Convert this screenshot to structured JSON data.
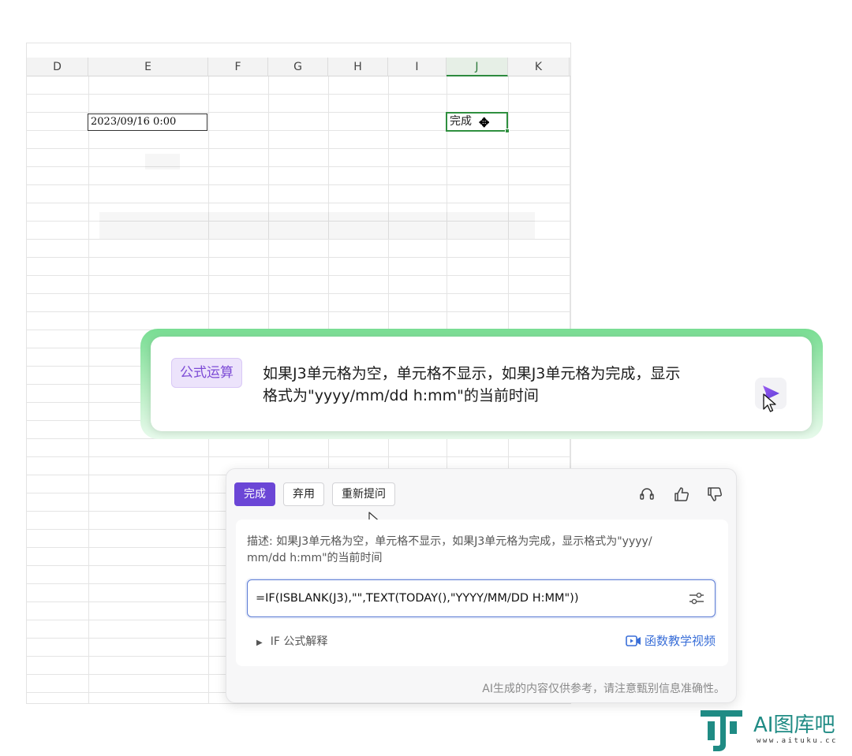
{
  "spreadsheet": {
    "columns": [
      {
        "label": "D",
        "selected": false
      },
      {
        "label": "E",
        "selected": false
      },
      {
        "label": "F",
        "selected": false
      },
      {
        "label": "G",
        "selected": false
      },
      {
        "label": "H",
        "selected": false
      },
      {
        "label": "I",
        "selected": false
      },
      {
        "label": "J",
        "selected": true
      },
      {
        "label": "K",
        "selected": false
      }
    ],
    "cell_e3_value": "2023/09/16 0:00",
    "cell_j3_value": "完成"
  },
  "prompt": {
    "tag": "公式运算",
    "text_line1": "如果J3单元格为空，单元格不显示，如果J3单元格为完成，显示",
    "text_line2": "格式为\"yyyy/mm/dd h:mm\"的当前时间"
  },
  "result": {
    "done_label": "完成",
    "discard_label": "弃用",
    "reask_label": "重新提问",
    "description_line1": "描述: 如果J3单元格为空，单元格不显示，如果J3单元格为完成，显示格式为\"yyyy/",
    "description_line2": "mm/dd h:mm\"的当前时间",
    "formula": "=IF(ISBLANK(J3),\"\",TEXT(TODAY(),\"YYYY/MM/DD H:MM\"))",
    "explain_label": "IF 公式解释",
    "video_label": "函数教学视频",
    "disclaimer": "AI生成的内容仅供参考，请注意甄别信息准确性。"
  },
  "watermark": {
    "name": "AI图库吧",
    "url": "www.aituku.cc"
  },
  "colors": {
    "accent_purple": "#6b46d6",
    "selection_green": "#2f8f3f",
    "link_blue": "#3a6fd8",
    "logo_teal": "#1f8b84"
  }
}
